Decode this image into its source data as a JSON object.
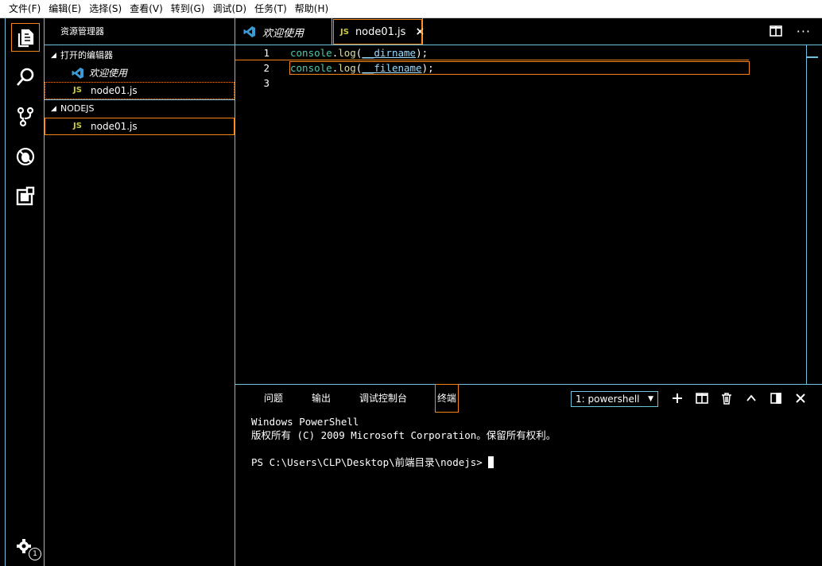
{
  "menubar": {
    "items": [
      "文件(F)",
      "编辑(E)",
      "选择(S)",
      "查看(V)",
      "转到(G)",
      "调试(D)",
      "任务(T)",
      "帮助(H)"
    ]
  },
  "activity_bar": {
    "items": [
      "files-icon",
      "search-icon",
      "source-control-icon",
      "debug-icon",
      "extensions-icon"
    ],
    "settings_badge": "1"
  },
  "sidebar": {
    "title": "资源管理器",
    "open_editors": {
      "header": "打开的编辑器",
      "items": [
        {
          "icon": "vscode-icon",
          "label": "欢迎使用"
        },
        {
          "icon": "JS",
          "label": "node01.js"
        }
      ]
    },
    "folder": {
      "header": "NODEJS",
      "items": [
        {
          "icon": "JS",
          "label": "node01.js"
        }
      ]
    }
  },
  "tabs": [
    {
      "label": "欢迎使用",
      "icon": "vscode-icon"
    },
    {
      "label": "node01.js",
      "icon": "JS",
      "close": "×"
    }
  ],
  "editor": {
    "lines": [
      {
        "num": "1",
        "obj": "console",
        "dot": ".",
        "fn": "log",
        "open": "(",
        "arg": "__dirname",
        "close": ");"
      },
      {
        "num": "2",
        "obj": "console",
        "dot": ".",
        "fn": "log",
        "open": "(",
        "arg": "__filename",
        "close": ");"
      },
      {
        "num": "3"
      }
    ]
  },
  "panel": {
    "tabs": [
      "问题",
      "输出",
      "调试控制台",
      "终端"
    ],
    "active_tab": "终端",
    "terminal_select": "1: powershell",
    "terminal_lines": [
      "Windows PowerShell",
      "版权所有 (C) 2009 Microsoft Corporation。保留所有权利。",
      "",
      "PS C:\\Users\\CLP\\Desktop\\前端目录\\nodejs> "
    ]
  },
  "colors": {
    "focus_border": "#f38518",
    "contrast_border": "#6fc3df",
    "js_badge": "#cbcb41"
  }
}
